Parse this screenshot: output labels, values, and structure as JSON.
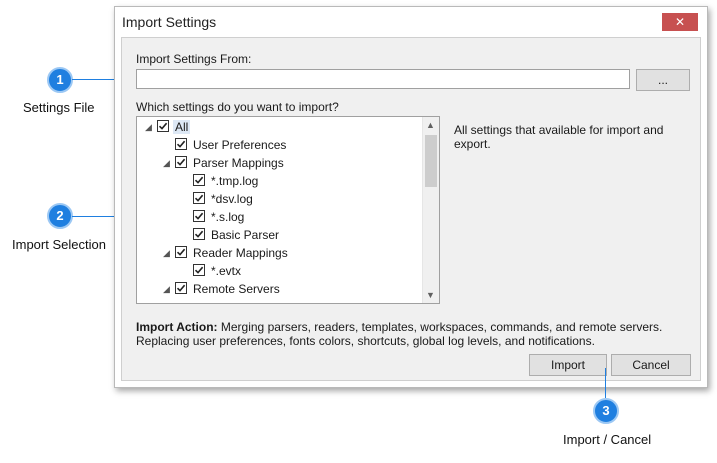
{
  "dialog": {
    "title": "Import Settings",
    "close_glyph": "✕",
    "import_from_label": "Import Settings From:",
    "path_value": "",
    "browse_label": "...",
    "which_label": "Which settings do you want to import?",
    "description": "All settings that available for import and export.",
    "action_bold": "Import Action:",
    "action_text": " Merging parsers, readers, templates, workspaces, commands, and remote servers. Replacing user preferences, fonts  colors, shortcuts, global log levels, and notifications.",
    "import_label": "Import",
    "cancel_label": "Cancel"
  },
  "tree": {
    "items": [
      {
        "label": "All",
        "checked": true,
        "level": 0,
        "expandable": true,
        "selected": true
      },
      {
        "label": "User Preferences",
        "checked": true,
        "level": 1,
        "expandable": false
      },
      {
        "label": "Parser Mappings",
        "checked": true,
        "level": 1,
        "expandable": true
      },
      {
        "label": "*.tmp.log",
        "checked": true,
        "level": 2,
        "expandable": false
      },
      {
        "label": "*dsv.log",
        "checked": true,
        "level": 2,
        "expandable": false
      },
      {
        "label": "*.s.log",
        "checked": true,
        "level": 2,
        "expandable": false
      },
      {
        "label": "Basic Parser",
        "checked": true,
        "level": 2,
        "expandable": false
      },
      {
        "label": "Reader Mappings",
        "checked": true,
        "level": 1,
        "expandable": true
      },
      {
        "label": "*.evtx",
        "checked": true,
        "level": 2,
        "expandable": false
      },
      {
        "label": "Remote Servers",
        "checked": true,
        "level": 1,
        "expandable": true
      }
    ]
  },
  "callouts": [
    {
      "number": "1",
      "label": "Settings File"
    },
    {
      "number": "2",
      "label": "Import Selection"
    },
    {
      "number": "3",
      "label": "Import / Cancel"
    }
  ],
  "colors": {
    "callout_blue": "#1f7fe0",
    "close_red": "#c75050",
    "selection": "#dde8f5"
  },
  "icons": {
    "expander": "triangle-expanded-icon",
    "scroll_up": "chevron-up-icon",
    "scroll_down": "chevron-down-icon"
  }
}
